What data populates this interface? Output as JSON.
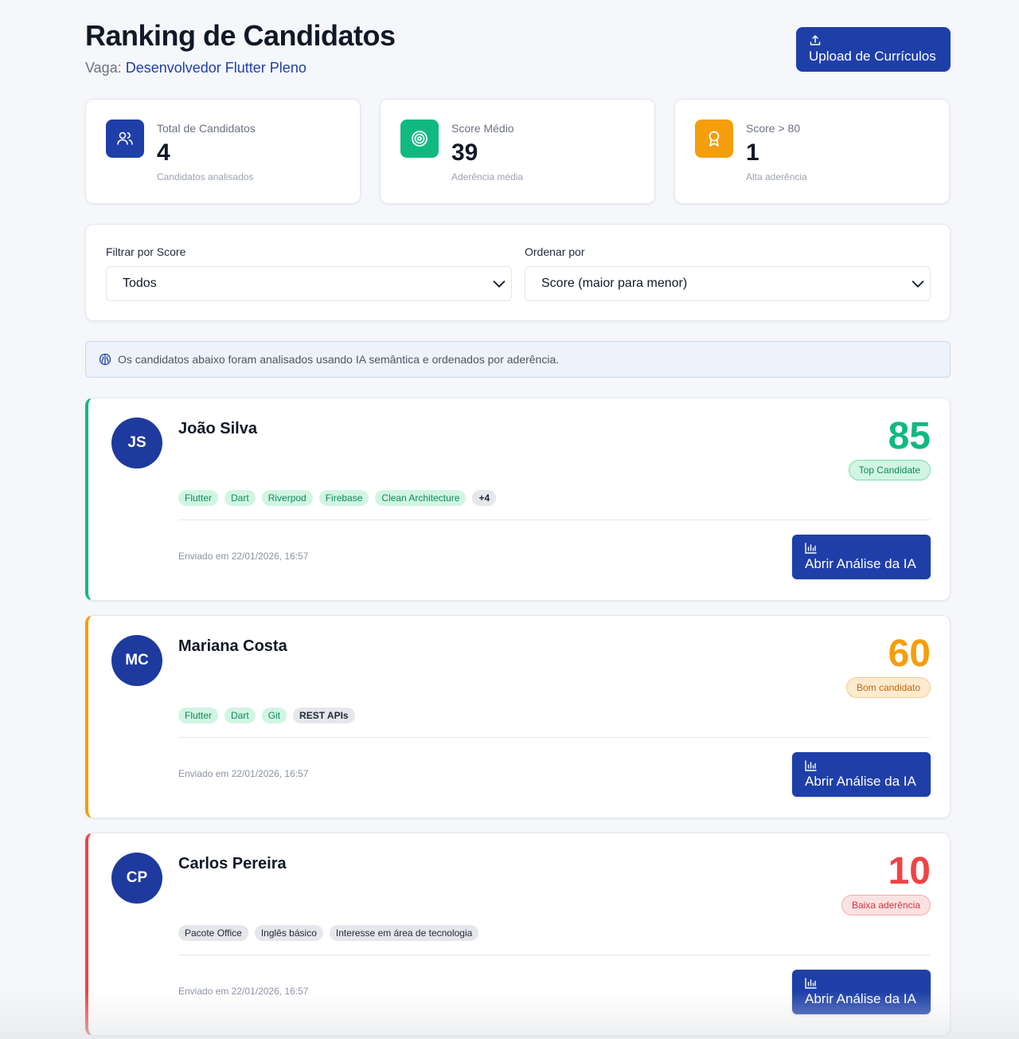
{
  "header": {
    "title": "Ranking de Candidatos",
    "job_prefix": "Vaga:",
    "job_title": "Desenvolvedor Flutter Pleno",
    "upload_label": "Upload de Currículos"
  },
  "stats": [
    {
      "label": "Total de Candidatos",
      "value": "4",
      "sub": "Candidatos analisados",
      "icon": "users-icon",
      "color": "#1e3fa8"
    },
    {
      "label": "Score Médio",
      "value": "39",
      "sub": "Aderência média",
      "icon": "target-icon",
      "color": "#10b981"
    },
    {
      "label": "Score > 80",
      "value": "1",
      "sub": "Alta aderência",
      "icon": "award-icon",
      "color": "#f59e0b"
    }
  ],
  "filters": {
    "score_label": "Filtrar por Score",
    "score_value": "Todos",
    "sort_label": "Ordenar por",
    "sort_value": "Score (maior para menor)"
  },
  "info": {
    "text": "Os candidatos abaixo foram analisados usando IA semântica e ordenados por aderência."
  },
  "candidates": [
    {
      "initials": "JS",
      "name": "João Silva",
      "score": "85",
      "badge": "Top Candidate",
      "accent": "#10b981",
      "tags": [
        "Flutter",
        "Dart",
        "Riverpod",
        "Firebase",
        "Clean Architecture"
      ],
      "extra": "+4",
      "sent": "Enviado em 22/01/2026, 16:57",
      "button": "Abrir Análise da IA"
    },
    {
      "initials": "MC",
      "name": "Mariana Costa",
      "score": "60",
      "badge": "Bom candidato",
      "accent": "#f59e0b",
      "tags": [
        "Flutter",
        "Dart",
        "Git"
      ],
      "extra": "REST APIs",
      "sent": "Enviado em 22/01/2026, 16:57",
      "button": "Abrir Análise da IA"
    },
    {
      "initials": "CP",
      "name": "Carlos Pereira",
      "score": "10",
      "badge": "Baixa aderência",
      "accent": "#ef4444",
      "tags": [],
      "gray_tags": [
        "Pacote Office",
        "Inglês básico",
        "Interesse em área de tecnologia"
      ],
      "sent": "Enviado em 22/01/2026, 16:57",
      "button": "Abrir Análise da IA"
    }
  ]
}
